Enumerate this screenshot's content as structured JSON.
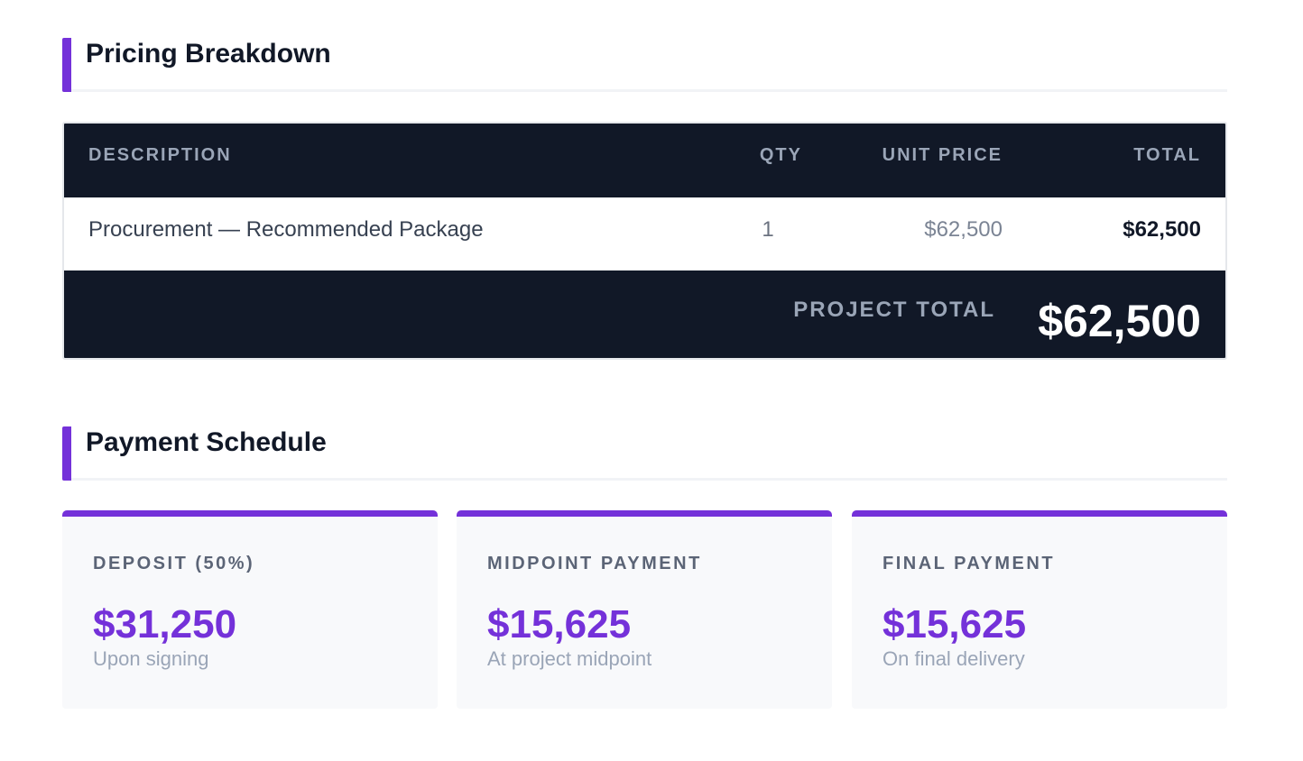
{
  "pricing": {
    "heading": "Pricing Breakdown",
    "columns": {
      "description": "DESCRIPTION",
      "qty": "QTY",
      "unit_price": "UNIT PRICE",
      "total": "TOTAL"
    },
    "rows": [
      {
        "description": "Procurement — Recommended Package",
        "qty": "1",
        "unit_price": "$62,500",
        "total": "$62,500"
      }
    ],
    "footer": {
      "label": "PROJECT TOTAL",
      "value": "$62,500"
    }
  },
  "payment": {
    "heading": "Payment Schedule",
    "cards": [
      {
        "label": "DEPOSIT (50%)",
        "amount": "$31,250",
        "note": "Upon signing"
      },
      {
        "label": "MIDPOINT PAYMENT",
        "amount": "$15,625",
        "note": "At project midpoint"
      },
      {
        "label": "FINAL PAYMENT",
        "amount": "$15,625",
        "note": "On final delivery"
      }
    ]
  },
  "colors": {
    "accent": "#7431d9",
    "dark": "#111827",
    "muted": "#9aa5b7"
  }
}
